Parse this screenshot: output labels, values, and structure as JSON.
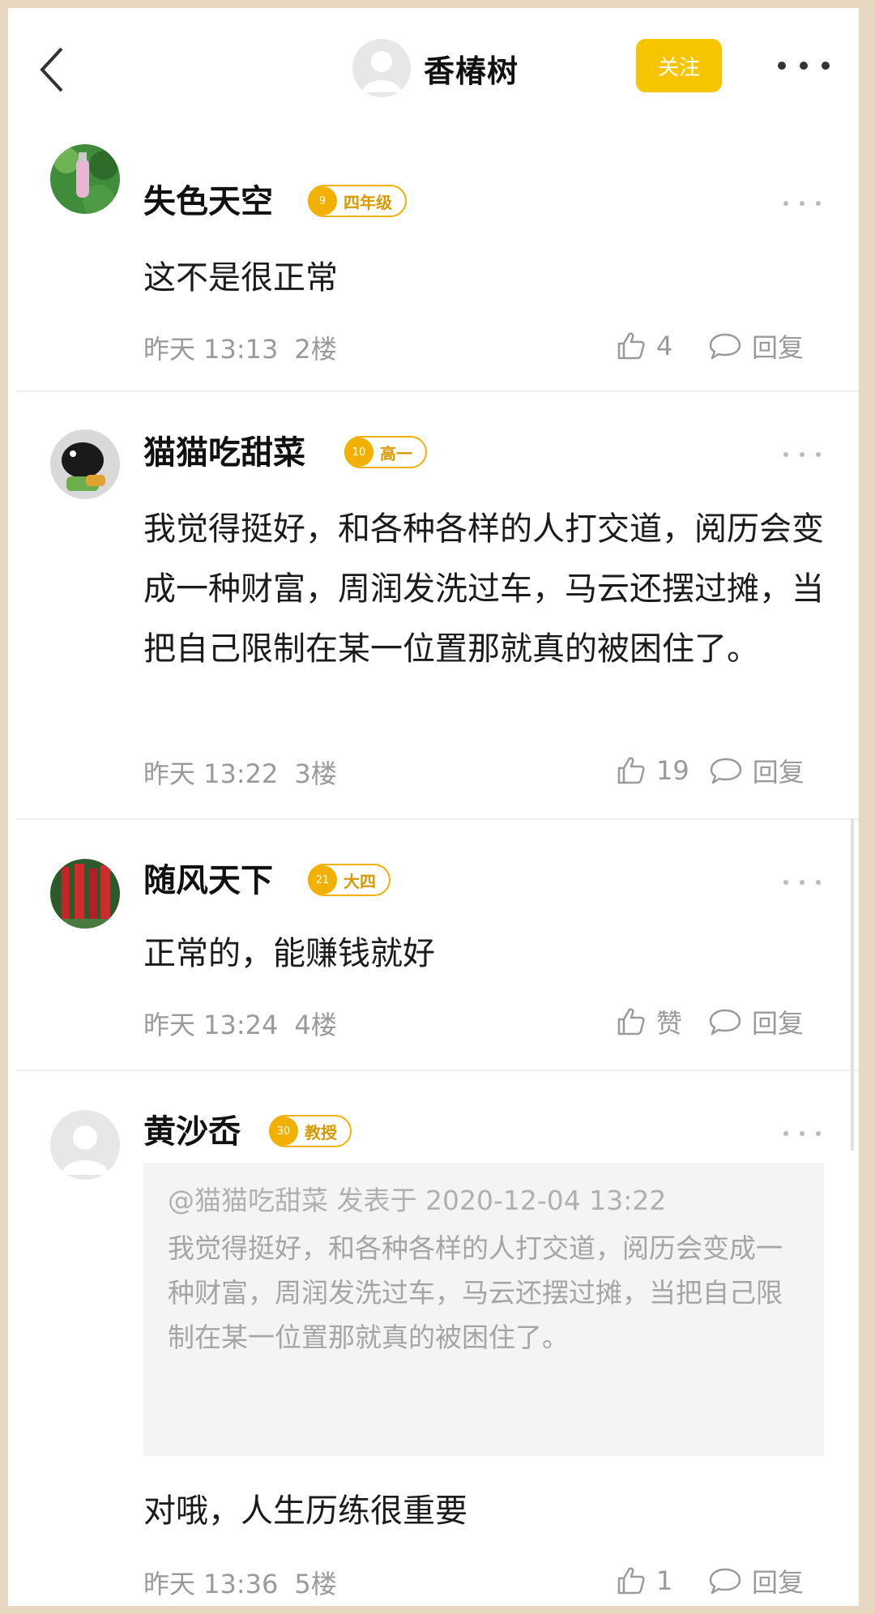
{
  "header": {
    "username": "香椿树",
    "follow_label": "关注"
  },
  "comments": [
    {
      "user": "失色天空",
      "level_num": "9",
      "level": "四年级",
      "text": "这不是很正常",
      "time": "昨天 13:13",
      "floor": "2楼",
      "likes": "4",
      "reply_label": "回复"
    },
    {
      "user": "猫猫吃甜菜",
      "level_num": "10",
      "level": "高一",
      "text": "我觉得挺好，和各种各样的人打交道，阅历会变成一种财富，周润发洗过车，马云还摆过摊，当把自己限制在某一位置那就真的被困住了。",
      "time": "昨天 13:22",
      "floor": "3楼",
      "likes": "19",
      "reply_label": "回复"
    },
    {
      "user": "随风天下",
      "level_num": "21",
      "level": "大四",
      "text": "正常的，能赚钱就好",
      "time": "昨天 13:24",
      "floor": "4楼",
      "likes": "赞",
      "reply_label": "回复"
    },
    {
      "user": "黄沙岙",
      "level_num": "30",
      "level": "教授",
      "quote_head": "@猫猫吃甜菜 发表于 2020-12-04 13:22",
      "quote_text": "我觉得挺好，和各种各样的人打交道，阅历会变成一种财富，周润发洗过车，马云还摆过摊，当把自己限制在某一位置那就真的被困住了。",
      "text": "对哦，人生历练很重要",
      "time": "昨天 13:36",
      "floor": "5楼",
      "likes": "1",
      "reply_label": "回复"
    }
  ],
  "colors": {
    "accent": "#f7c400",
    "level_badge": "#f2b100",
    "meta_text": "#9a9a9a",
    "quote_bg": "#f4f4f4"
  },
  "icons": [
    "back-arrow-icon",
    "more-icon",
    "thumbs-up-icon",
    "comment-bubble-icon",
    "medal-icon"
  ]
}
